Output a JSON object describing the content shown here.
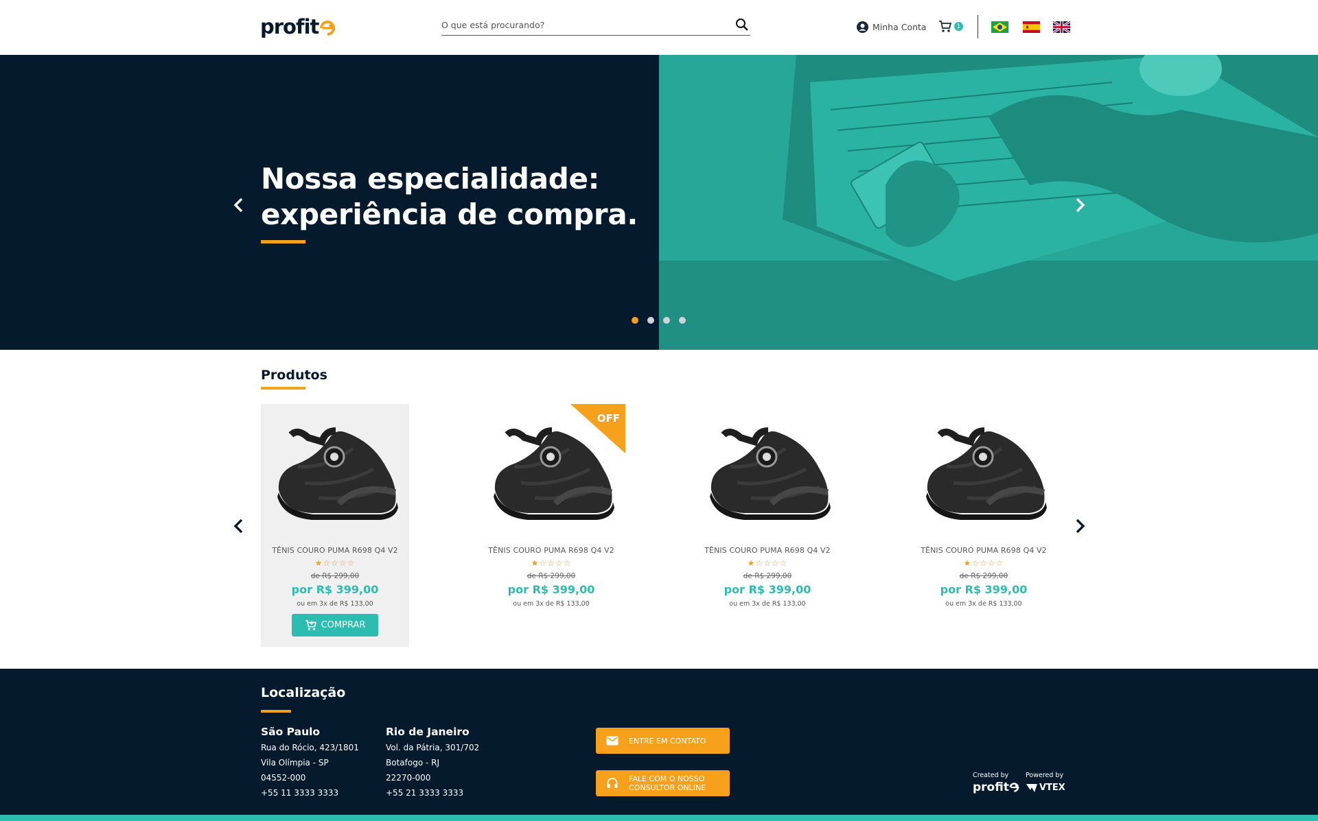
{
  "header": {
    "logo": "profit",
    "search_placeholder": "O que está procurando?",
    "account_label": "Minha Conta",
    "cart_count": "1",
    "flags": [
      "Brasil",
      "España",
      "United Kingdom"
    ]
  },
  "hero": {
    "title_line1": "Nossa especialidade:",
    "title_line2": "experiência de compra.",
    "slides_total": 4,
    "active_slide": 1
  },
  "products": {
    "title": "Produtos",
    "items": [
      {
        "name": "TÊNIS COURO PUMA R698 Q4 V2",
        "old_price": "de R$ 299,00",
        "price": "por R$ 399,00",
        "installments": "ou em 3x de R$ 133,00",
        "rating": 1,
        "off": false,
        "hover": true
      },
      {
        "name": "TÊNIS COURO PUMA R698 Q4 V2",
        "old_price": "de R$ 299,00",
        "price": "por R$ 399,00",
        "installments": "ou em 3x de R$ 133,00",
        "rating": 1,
        "off": true,
        "hover": false
      },
      {
        "name": "TÊNIS COURO PUMA R698 Q4 V2",
        "old_price": "de R$ 299,00",
        "price": "por R$ 399,00",
        "installments": "ou em 3x de R$ 133,00",
        "rating": 1,
        "off": false,
        "hover": false
      },
      {
        "name": "TÊNIS COURO PUMA R698 Q4 V2",
        "old_price": "de R$ 299,00",
        "price": "por R$ 399,00",
        "installments": "ou em 3x de R$ 133,00",
        "rating": 1,
        "off": false,
        "hover": false
      }
    ],
    "off_label": "OFF",
    "buy_label": "COMPRAR"
  },
  "footer": {
    "title": "Localização",
    "cities": [
      {
        "name": "São Paulo",
        "lines": [
          "Rua do Rócio, 423/1801",
          "Vila Olímpia - SP",
          "04552-000",
          "+55 11  3333 3333"
        ]
      },
      {
        "name": "Rio de Janeiro",
        "lines": [
          "Vol. da Pátria, 301/702",
          "Botafogo - RJ",
          "22270-000",
          "+55 21  3333 3333"
        ]
      }
    ],
    "contact_button": "ENTRE EM CONTATO",
    "consultant_button_line1": "FALE COM O NOSSO",
    "consultant_button_line2": "CONSULTOR ONLINE",
    "created_by_label": "Created by",
    "created_by_brand": "profit",
    "powered_by_label": "Powered by",
    "powered_by_brand": "VTEX"
  },
  "colors": {
    "navy": "#061a2e",
    "orange": "#f7a01b",
    "teal": "#2cbcb0"
  }
}
